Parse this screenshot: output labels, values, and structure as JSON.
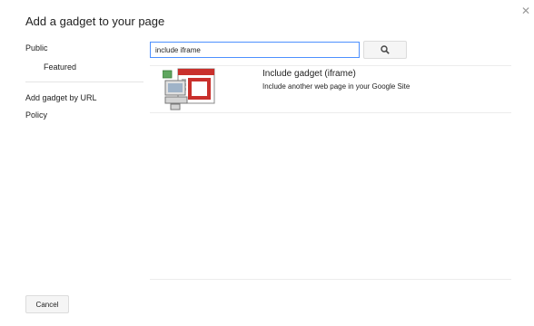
{
  "dialog": {
    "title": "Add a gadget to your page"
  },
  "sidebar": {
    "items": [
      {
        "label": "Public"
      },
      {
        "label": "Featured"
      },
      {
        "label": "Add gadget by URL"
      },
      {
        "label": "Policy"
      }
    ]
  },
  "search": {
    "value": "include iframe",
    "button_icon": "search-icon"
  },
  "results": [
    {
      "title": "Include gadget (iframe)",
      "description": "Include another web page in your Google Site",
      "icon": "iframe-gadget-icon"
    }
  ],
  "footer": {
    "cancel_label": "Cancel"
  },
  "colors": {
    "input_focus_border": "#4d90fe",
    "icon_red": "#c9302c"
  }
}
